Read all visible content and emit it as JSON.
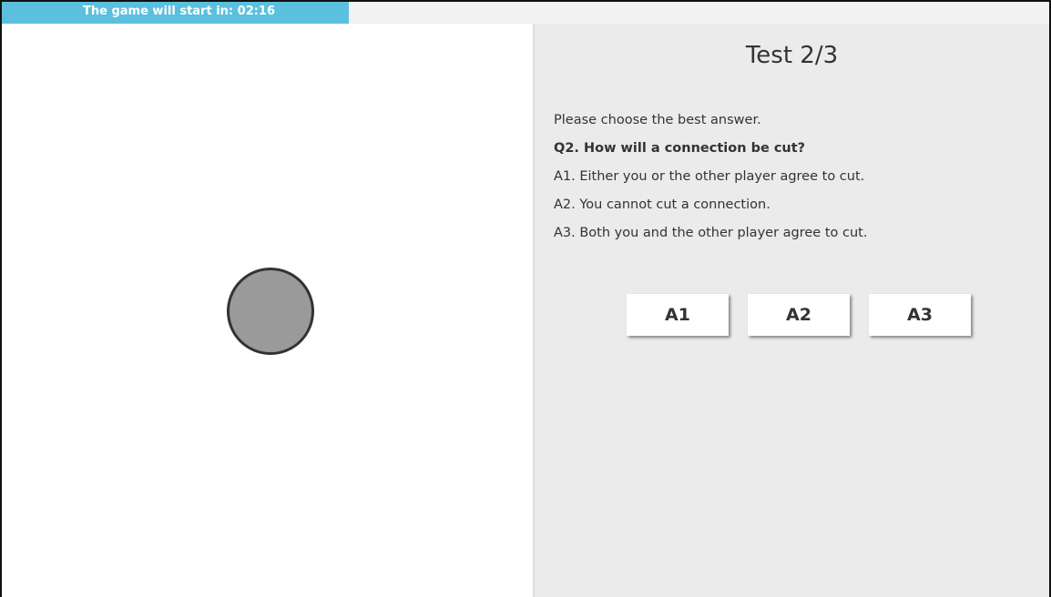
{
  "timer": {
    "text": "The game will start in: 02:16"
  },
  "test": {
    "title": "Test 2/3",
    "instruction": "Please choose the best answer.",
    "question": "Q2. How will a connection be cut?",
    "options": [
      "A1. Either you or the other player agree to cut.",
      "A2. You cannot cut a connection.",
      "A3. Both you and the other player agree to cut."
    ],
    "buttons": [
      "A1",
      "A2",
      "A3"
    ]
  },
  "colors": {
    "timer_bar": "#5bc0de",
    "node_fill": "#9a9a9a",
    "panel_bg": "#ebebeb"
  }
}
